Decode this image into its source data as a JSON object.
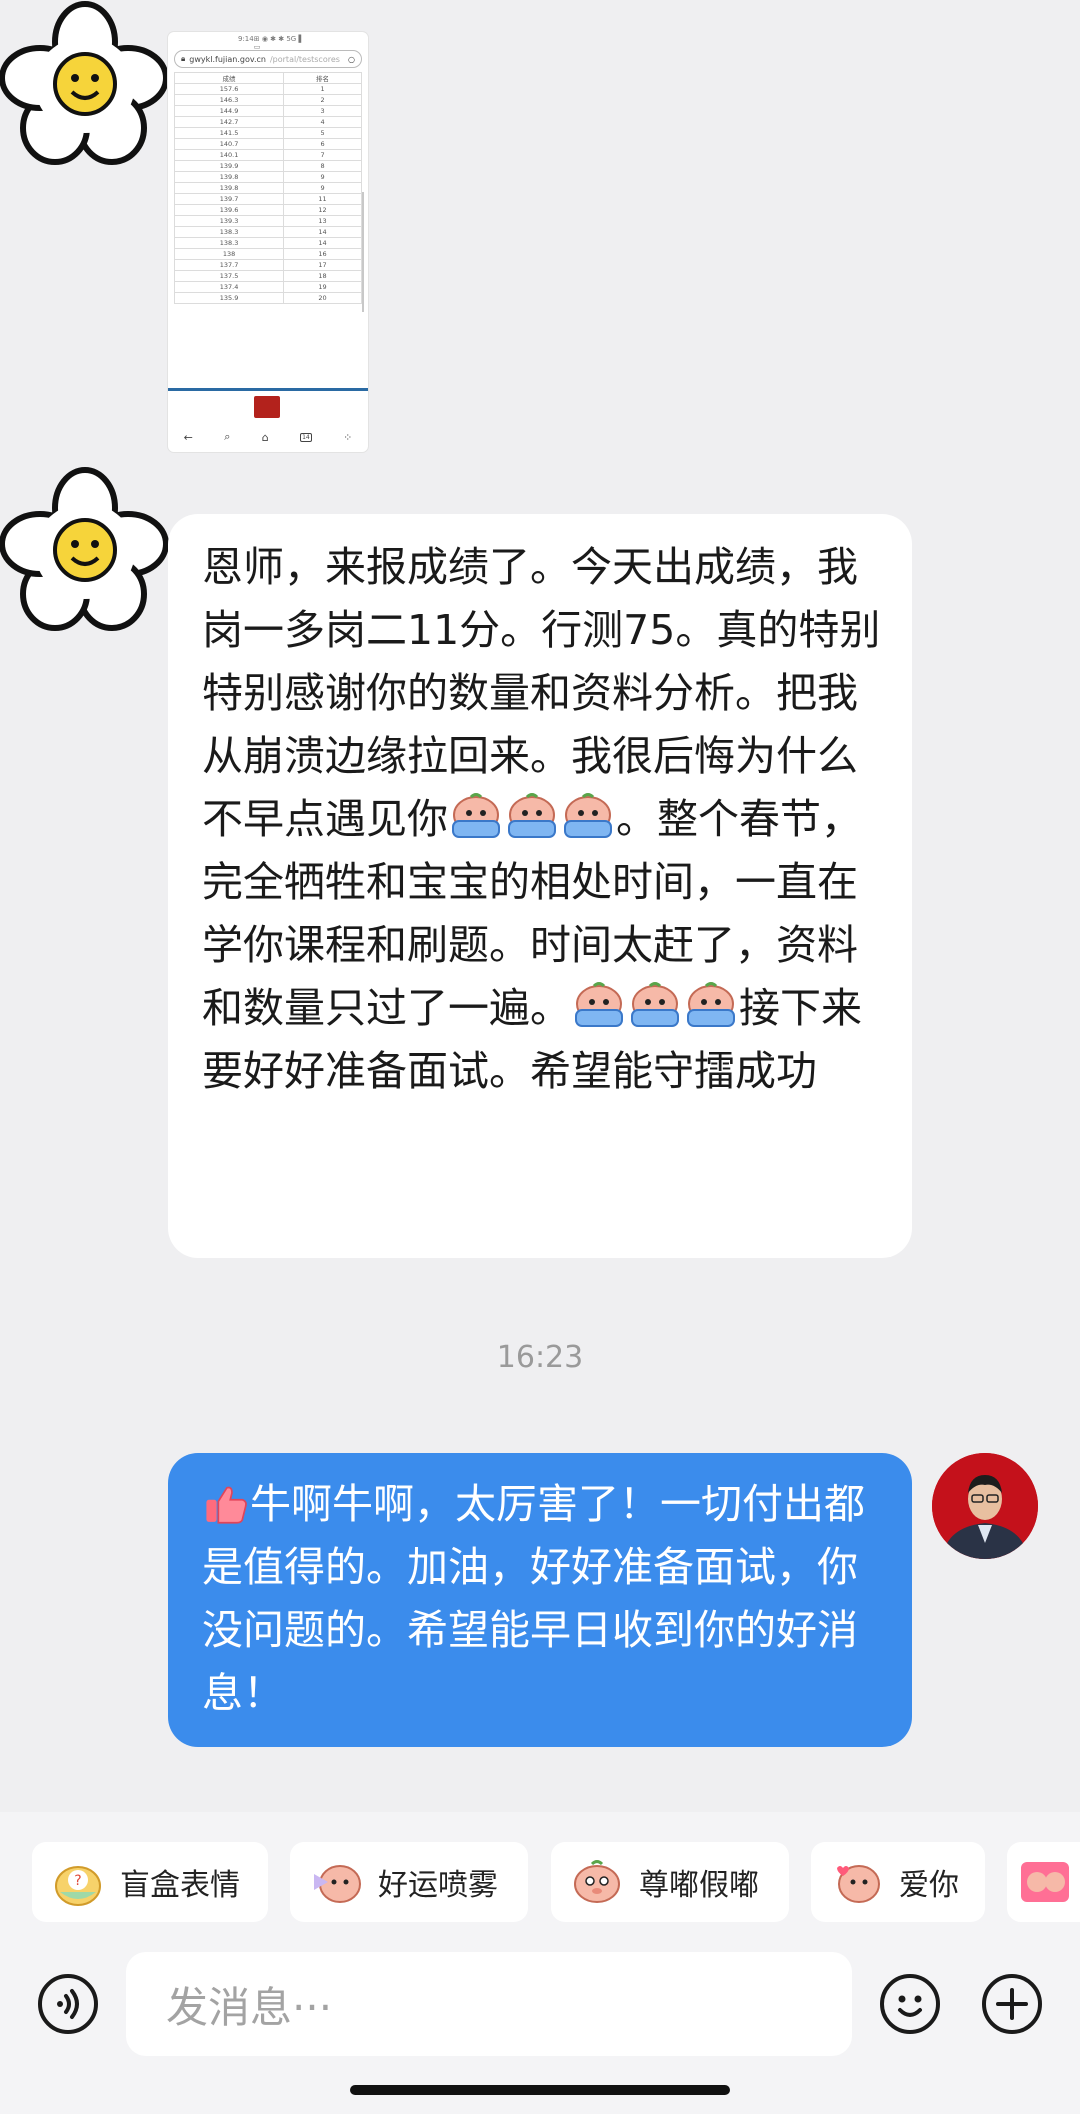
{
  "image_thumbnail": {
    "status_time": "9:14",
    "status_icons": "⊞ ◉ ✱ ✱ 5G ▌ ▭",
    "url_host": "gwykl.fujian.gov.cn",
    "url_path": "/portal/testscores",
    "table_headers": [
      "成绩",
      "排名"
    ],
    "table_rows": [
      [
        "157.6",
        "1"
      ],
      [
        "146.3",
        "2"
      ],
      [
        "144.9",
        "3"
      ],
      [
        "142.7",
        "4"
      ],
      [
        "141.5",
        "5"
      ],
      [
        "140.7",
        "6"
      ],
      [
        "140.1",
        "7"
      ],
      [
        "139.9",
        "8"
      ],
      [
        "139.8",
        "9"
      ],
      [
        "139.8",
        "9"
      ],
      [
        "139.7",
        "11"
      ],
      [
        "139.6",
        "12"
      ],
      [
        "139.3",
        "13"
      ],
      [
        "138.3",
        "14"
      ],
      [
        "138.3",
        "14"
      ],
      [
        "138",
        "16"
      ],
      [
        "137.7",
        "17"
      ],
      [
        "137.5",
        "18"
      ],
      [
        "137.4",
        "19"
      ],
      [
        "135.9",
        "20"
      ]
    ],
    "nav_icons": [
      "back-icon",
      "search-icon",
      "home-icon",
      "tabs-icon",
      "menu-icon"
    ],
    "tabs_count": "14"
  },
  "messages": {
    "incoming": {
      "part1": "恩师，来报成绩了。今天出成绩，我岗一多岗二11分。行测75。真的特别特别感谢你的数量和资料分析。把我从崩溃边缘拉回来。我很后悔为什么不早点遇见你",
      "part2": "。整个春节，完全牺牲和宝宝的相处时间，一直在学你课程和刷题。时间太赶了，资料和数量只过了一遍。",
      "part3": "接下来要好好准备面试。希望能守擂成功"
    },
    "timestamp": "16:23",
    "outgoing": {
      "text": "牛啊牛啊，太厉害了！一切付出都是值得的。加油，好好准备面试，你没问题的。希望能早日收到你的好消息！"
    }
  },
  "quick_stickers": [
    {
      "label": "盲盒表情"
    },
    {
      "label": "好运喷雾"
    },
    {
      "label": "尊嘟假嘟"
    },
    {
      "label": "爱你"
    }
  ],
  "input": {
    "placeholder": "发消息···"
  },
  "colors": {
    "background": "#efeff1",
    "outgoing_bubble": "#3b8cec",
    "incoming_bubble": "#ffffff",
    "timestamp": "#9a9a9a"
  }
}
